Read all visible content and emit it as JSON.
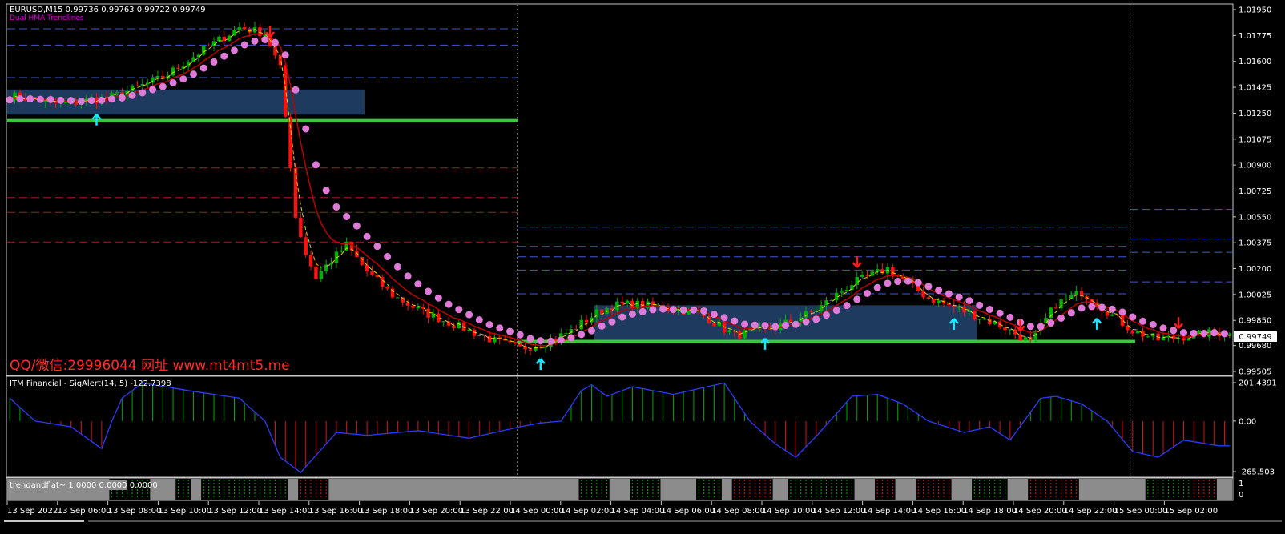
{
  "header": {
    "symbol_line": "EURUSD,M15 0.99736 0.99763 0.99722 0.99749",
    "indicator_tag": "Dual HMA Trendlines"
  },
  "watermark": "QQ/微信:29996044 网址 www.mt4mt5.me",
  "current_price_label": "0.99749",
  "colors": {
    "background": "#000000",
    "bull_candle": "#00b000",
    "bear_candle": "#ff1010",
    "dots": "#e07ad8",
    "support_line": "#33cc33",
    "box": "#1f3a5f",
    "box_teal": "#1b5555",
    "blue_dash": "#3c5ad8",
    "red_dash": "#a02020",
    "ma_red": "#c00000",
    "ma_yellow": "#d8d800",
    "osc_line": "#2a3cff",
    "osc_green": "#00aa00",
    "osc_red": "#dd1010",
    "flat_gray": "#8c8c8c"
  },
  "chart_data": [
    {
      "type": "candlestick",
      "name": "EURUSD,M15",
      "y_ticks": [
        "1.01950",
        "1.01775",
        "1.01600",
        "1.01425",
        "1.01250",
        "1.01075",
        "1.00900",
        "1.00725",
        "1.00550",
        "1.00375",
        "1.00200",
        "1.00025",
        "0.99850",
        "0.99680",
        "0.99505"
      ],
      "ylim": [
        0.99505,
        1.0195
      ],
      "x_ticks": [
        "13 Sep 2022",
        "13 Sep 06:00",
        "13 Sep 08:00",
        "13 Sep 10:00",
        "13 Sep 12:00",
        "13 Sep 14:00",
        "13 Sep 16:00",
        "13 Sep 18:00",
        "13 Sep 20:00",
        "13 Sep 22:00",
        "14 Sep 00:00",
        "14 Sep 02:00",
        "14 Sep 04:00",
        "14 Sep 06:00",
        "14 Sep 08:00",
        "14 Sep 10:00",
        "14 Sep 12:00",
        "14 Sep 14:00",
        "14 Sep 16:00",
        "14 Sep 18:00",
        "14 Sep 20:00",
        "14 Sep 22:00",
        "15 Sep 00:00",
        "15 Sep 02:00"
      ],
      "bar_count": 240,
      "price_path_x": [
        0,
        10,
        20,
        30,
        38,
        45,
        50,
        53,
        55,
        56,
        58,
        60,
        62,
        66,
        70,
        75,
        80,
        85,
        90,
        95,
        100,
        105,
        110,
        112,
        115,
        118,
        122,
        128,
        135,
        142,
        150,
        158,
        165,
        172,
        180,
        188,
        195,
        200,
        205,
        210,
        215,
        220,
        225,
        230,
        236,
        240
      ],
      "price_path_y": [
        1.0137,
        1.0131,
        1.0136,
        1.0149,
        1.0168,
        1.0183,
        1.0179,
        1.0155,
        1.009,
        1.0055,
        1.003,
        1.0014,
        1.0022,
        1.0036,
        1.0018,
        1.0002,
        0.9992,
        0.9985,
        0.9978,
        0.9971,
        0.9966,
        0.997,
        0.9978,
        0.9983,
        0.999,
        0.9995,
        0.9996,
        0.9994,
        0.999,
        0.9975,
        0.998,
        0.9992,
        1.001,
        1.002,
        1.0,
        0.999,
        0.998,
        0.997,
        0.9996,
        1.0004,
        0.9991,
        0.9978,
        0.9972,
        0.9974,
        0.9977,
        0.9975
      ],
      "blue_dashed_levels": [
        {
          "x_start": 0,
          "x_end": 100,
          "values": [
            1.0182,
            1.0171,
            1.0149
          ]
        },
        {
          "x_start": 100,
          "x_end": 220,
          "values": [
            1.0048,
            1.0035,
            1.0028,
            1.0019,
            1.0003
          ]
        },
        {
          "x_start": 220,
          "x_end": 240,
          "values": [
            1.006,
            1.004,
            1.0031,
            1.0011
          ]
        }
      ],
      "red_dashed_levels": {
        "x_start": 0,
        "x_end": 100,
        "values": [
          1.0088,
          1.0068,
          1.0058,
          1.0038
        ]
      },
      "support_lines": [
        {
          "x_start": 0,
          "x_end": 100,
          "value": 1.012
        },
        {
          "x_start": 100,
          "x_end": 221,
          "value": 0.99708
        }
      ],
      "boxes": [
        {
          "x_start": 0,
          "x_end": 70,
          "top": 1.0141,
          "bottom": 1.0124
        },
        {
          "x_start": 115,
          "x_end": 190,
          "top": 0.99952,
          "bottom": 0.99708
        }
      ],
      "period_separators_x": [
        100,
        220
      ],
      "up_arrows_x": [
        17,
        104,
        148,
        185,
        213
      ],
      "down_arrows_x": [
        51,
        166,
        198,
        229
      ]
    },
    {
      "type": "bar",
      "name": "ITM Financial - SigAlert(14, 5) -122.7398",
      "y_ticks": [
        "201.4391",
        "0.00",
        "-265.503"
      ],
      "ylim": [
        -265.503,
        201.4391
      ],
      "osc_path_x": [
        0,
        5,
        12,
        18,
        20,
        22,
        26,
        35,
        45,
        50,
        53,
        57,
        60,
        64,
        70,
        80,
        90,
        95,
        100,
        104,
        108,
        112,
        114,
        117,
        122,
        130,
        140,
        145,
        150,
        154,
        158,
        165,
        170,
        175,
        180,
        187,
        192,
        196,
        202,
        205,
        210,
        215,
        220,
        225,
        230,
        237
      ],
      "osc_path_y": [
        120,
        0,
        -30,
        -145,
        0,
        120,
        200,
        160,
        120,
        0,
        -190,
        -270,
        -180,
        -60,
        -75,
        -50,
        -90,
        -60,
        -30,
        -10,
        0,
        160,
        190,
        130,
        180,
        140,
        200,
        0,
        -120,
        -190,
        -80,
        130,
        140,
        90,
        0,
        -60,
        -30,
        -100,
        120,
        130,
        90,
        0,
        -160,
        -190,
        -100,
        -130
      ]
    },
    {
      "type": "heatmap",
      "name": "trendandflat~ 1.0000 0.0000 0.0000",
      "y_ticks": [
        "1",
        "0"
      ],
      "segments": [
        {
          "from": 0,
          "to": 20,
          "state": "flat"
        },
        {
          "from": 20,
          "to": 28,
          "state": "up"
        },
        {
          "from": 28,
          "to": 33,
          "state": "flat"
        },
        {
          "from": 33,
          "to": 36,
          "state": "up"
        },
        {
          "from": 36,
          "to": 38,
          "state": "flat"
        },
        {
          "from": 38,
          "to": 55,
          "state": "up"
        },
        {
          "from": 55,
          "to": 57,
          "state": "flat"
        },
        {
          "from": 57,
          "to": 63,
          "state": "down"
        },
        {
          "from": 63,
          "to": 112,
          "state": "flat"
        },
        {
          "from": 112,
          "to": 118,
          "state": "up"
        },
        {
          "from": 118,
          "to": 122,
          "state": "flat"
        },
        {
          "from": 122,
          "to": 128,
          "state": "up"
        },
        {
          "from": 128,
          "to": 135,
          "state": "flat"
        },
        {
          "from": 135,
          "to": 140,
          "state": "up"
        },
        {
          "from": 140,
          "to": 142,
          "state": "flat"
        },
        {
          "from": 142,
          "to": 150,
          "state": "down"
        },
        {
          "from": 150,
          "to": 153,
          "state": "flat"
        },
        {
          "from": 153,
          "to": 166,
          "state": "up"
        },
        {
          "from": 166,
          "to": 170,
          "state": "flat"
        },
        {
          "from": 170,
          "to": 174,
          "state": "down"
        },
        {
          "from": 174,
          "to": 178,
          "state": "flat"
        },
        {
          "from": 178,
          "to": 185,
          "state": "down"
        },
        {
          "from": 185,
          "to": 189,
          "state": "flat"
        },
        {
          "from": 189,
          "to": 196,
          "state": "up"
        },
        {
          "from": 196,
          "to": 200,
          "state": "flat"
        },
        {
          "from": 200,
          "to": 210,
          "state": "down"
        },
        {
          "from": 210,
          "to": 223,
          "state": "flat"
        },
        {
          "from": 223,
          "to": 232,
          "state": "up"
        },
        {
          "from": 232,
          "to": 237,
          "state": "down"
        },
        {
          "from": 237,
          "to": 240,
          "state": "flat"
        }
      ]
    }
  ]
}
